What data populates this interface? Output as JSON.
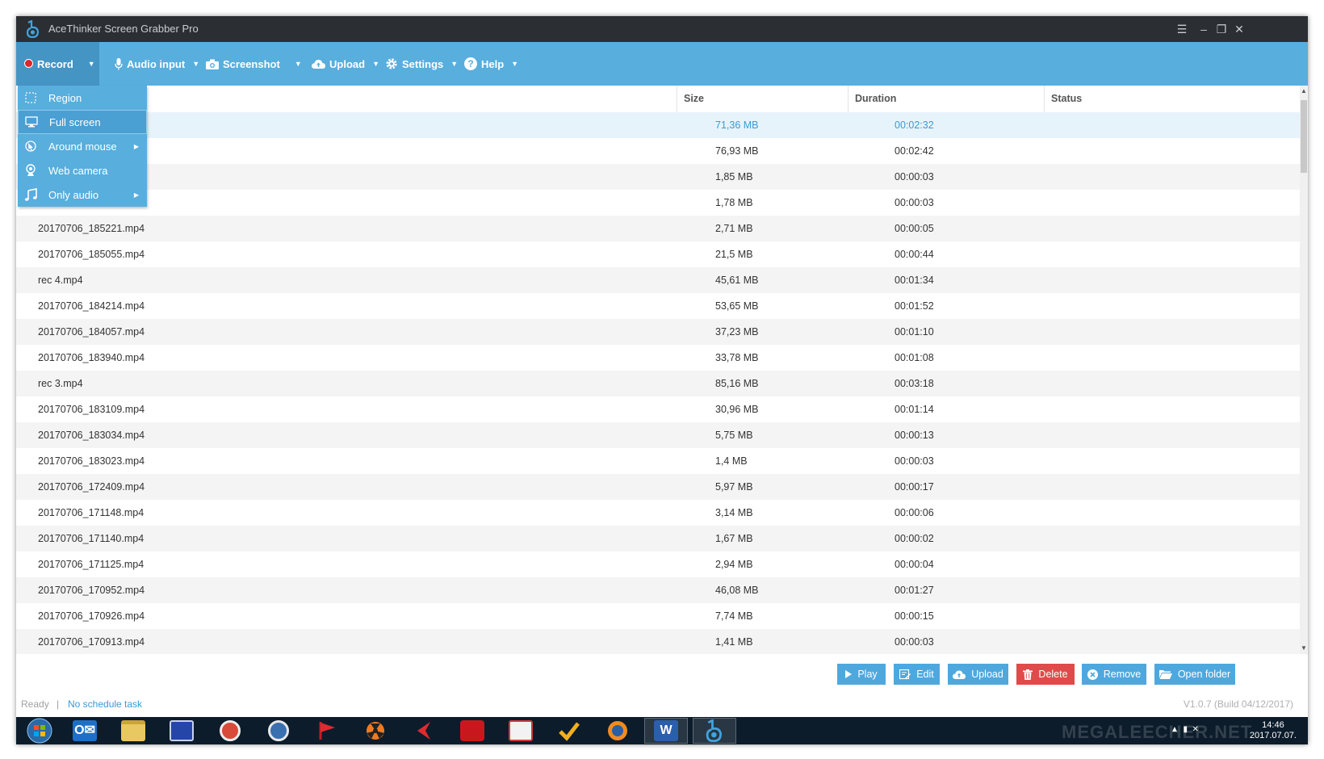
{
  "window": {
    "title": "AceThinker Screen Grabber Pro"
  },
  "toolbar": {
    "record": "Record",
    "audio_input": "Audio input",
    "screenshot": "Screenshot",
    "upload": "Upload",
    "settings": "Settings",
    "help": "Help"
  },
  "record_menu": {
    "items": [
      {
        "label": "Region",
        "icon": "region-icon"
      },
      {
        "label": "Full screen",
        "icon": "monitor-icon"
      },
      {
        "label": "Around mouse",
        "icon": "mouse-icon"
      },
      {
        "label": "Web camera",
        "icon": "webcam-icon"
      },
      {
        "label": "Only audio",
        "icon": "music-note-icon"
      }
    ]
  },
  "table": {
    "columns": {
      "size": "Size",
      "duration": "Duration",
      "status": "Status"
    },
    "rows": [
      {
        "name": "",
        "size": "71,36 MB",
        "duration": "00:02:32",
        "status": ""
      },
      {
        "name": "",
        "size": "76,93 MB",
        "duration": "00:02:42",
        "status": ""
      },
      {
        "name": "",
        "size": "1,85 MB",
        "duration": "00:00:03",
        "status": ""
      },
      {
        "name": "",
        "size": "1,78 MB",
        "duration": "00:00:03",
        "status": ""
      },
      {
        "name": "20170706_185221.mp4",
        "size": "2,71 MB",
        "duration": "00:00:05",
        "status": ""
      },
      {
        "name": "20170706_185055.mp4",
        "size": "21,5 MB",
        "duration": "00:00:44",
        "status": ""
      },
      {
        "name": "rec 4.mp4",
        "size": "45,61 MB",
        "duration": "00:01:34",
        "status": ""
      },
      {
        "name": "20170706_184214.mp4",
        "size": "53,65 MB",
        "duration": "00:01:52",
        "status": ""
      },
      {
        "name": "20170706_184057.mp4",
        "size": "37,23 MB",
        "duration": "00:01:10",
        "status": ""
      },
      {
        "name": "20170706_183940.mp4",
        "size": "33,78 MB",
        "duration": "00:01:08",
        "status": ""
      },
      {
        "name": "rec 3.mp4",
        "size": "85,16 MB",
        "duration": "00:03:18",
        "status": ""
      },
      {
        "name": "20170706_183109.mp4",
        "size": "30,96 MB",
        "duration": "00:01:14",
        "status": ""
      },
      {
        "name": "20170706_183034.mp4",
        "size": "5,75 MB",
        "duration": "00:00:13",
        "status": ""
      },
      {
        "name": "20170706_183023.mp4",
        "size": "1,4 MB",
        "duration": "00:00:03",
        "status": ""
      },
      {
        "name": "20170706_172409.mp4",
        "size": "5,97 MB",
        "duration": "00:00:17",
        "status": ""
      },
      {
        "name": "20170706_171148.mp4",
        "size": "3,14 MB",
        "duration": "00:00:06",
        "status": ""
      },
      {
        "name": "20170706_171140.mp4",
        "size": "1,67 MB",
        "duration": "00:00:02",
        "status": ""
      },
      {
        "name": "20170706_171125.mp4",
        "size": "2,94 MB",
        "duration": "00:00:04",
        "status": ""
      },
      {
        "name": "20170706_170952.mp4",
        "size": "46,08 MB",
        "duration": "00:01:27",
        "status": ""
      },
      {
        "name": "20170706_170926.mp4",
        "size": "7,74 MB",
        "duration": "00:00:15",
        "status": ""
      },
      {
        "name": "20170706_170913.mp4",
        "size": "1,41 MB",
        "duration": "00:00:03",
        "status": ""
      }
    ]
  },
  "actions": {
    "play": "Play",
    "edit": "Edit",
    "upload": "Upload",
    "delete": "Delete",
    "remove": "Remove",
    "open_folder": "Open folder"
  },
  "status": {
    "state": "Ready",
    "separator": "|",
    "schedule": "No schedule task",
    "version": "V1.0.7 (Build 04/12/2017)"
  },
  "taskbar": {
    "watermark": "MEGALEECHER.NET",
    "time": "14:46",
    "date": "2017.07.07.",
    "apps": [
      "windows-start-icon",
      "outlook-icon",
      "file-explorer-icon",
      "save-disk-icon",
      "globe-app-icon",
      "media-app-icon",
      "red-flag-app-icon",
      "radiation-app-icon",
      "red-arrow-app-icon",
      "red-box-app-icon",
      "handshake-app-icon",
      "checkmark-app-icon",
      "firefox-icon",
      "word-icon",
      "screen-grabber-icon"
    ]
  },
  "colors": {
    "toolbar": "#58aedd",
    "titlebar": "#2b2f33",
    "accent": "#3b9ad3",
    "delete": "#e04a4a"
  }
}
